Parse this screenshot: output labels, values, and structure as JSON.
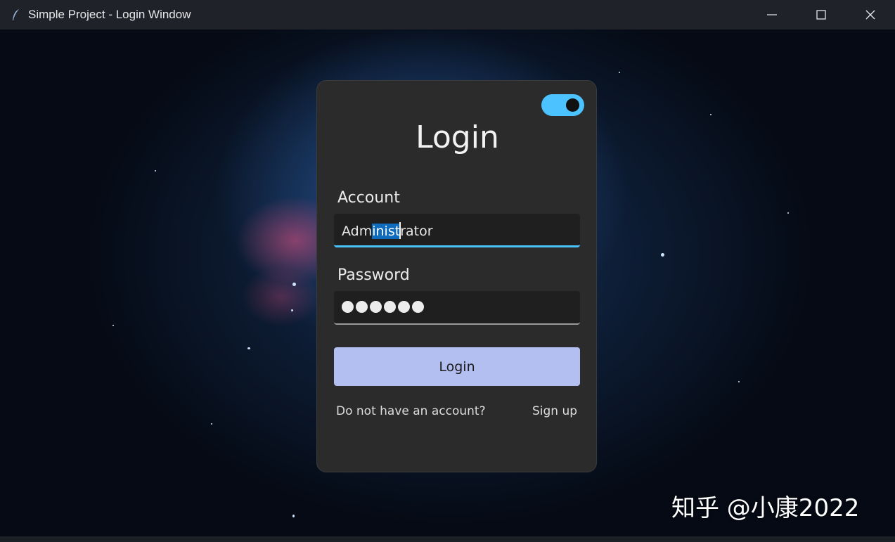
{
  "window": {
    "title": "Simple Project - Login Window",
    "icon": "feather-icon",
    "controls": [
      "minimize-icon",
      "maximize-icon",
      "close-icon"
    ]
  },
  "colors": {
    "accent": "#4cc2ff",
    "card_bg": "#2b2b2b",
    "button_bg": "#b3bff0",
    "selection": "#0f6cbd"
  },
  "login": {
    "theme_toggle_on": true,
    "title": "Login",
    "account_label": "Account",
    "account_value_before": "Adm",
    "account_value_selected": "inist",
    "account_value_after": "rator",
    "password_label": "Password",
    "password_mask_count": 6,
    "button_label": "Login",
    "no_account_text": "Do not have an account?",
    "signup_link": "Sign up"
  },
  "watermark": "知乎 @小康2022"
}
